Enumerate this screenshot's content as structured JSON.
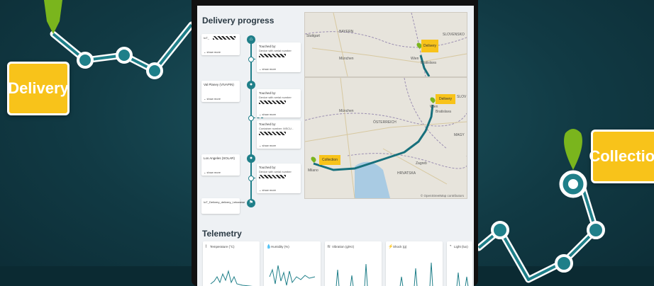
{
  "background_tags": {
    "delivery": "Delivery",
    "collection": "Collection"
  },
  "delivery_progress": {
    "title": "Delivery progress",
    "stops": [
      {
        "label": "",
        "view_more": "show more"
      },
      {
        "label": "Val Planey (VIVAPIN)",
        "view_more": "show more"
      },
      {
        "label": "Los Angeles (SOLAR)",
        "view_more": "show more"
      },
      {
        "label": "IoT_Delivery_delivery_Lebanese",
        "view_more": ""
      }
    ],
    "events": [
      {
        "title": "Touched by:",
        "sub": "Device with serial number",
        "view_more": "show more"
      },
      {
        "title": "Touched by:",
        "sub": "Device with serial number",
        "view_more": "show more"
      },
      {
        "title": "Touched by:",
        "sub": "Container number: MSCU -",
        "view_more": "show more"
      },
      {
        "title": "Touched by:",
        "sub": "Device with serial number",
        "view_more": "show more"
      }
    ]
  },
  "maps": {
    "top": {
      "labels": [
        "Stuttgart",
        "BAYERN",
        "München",
        "SLOVENSKO",
        "Wien",
        "Bratislava"
      ],
      "tag": "Delivery"
    },
    "bottom": {
      "labels": [
        "München",
        "ÖSTERREICH",
        "Wien",
        "Bratislava",
        "Zagreb",
        "HRVATSKA",
        "Milano",
        "SLOV",
        "MAGY"
      ],
      "tag_delivery": "Delivery",
      "tag_collection": "Collection",
      "copyright": "© OpenStreetMap contributors"
    }
  },
  "telemetry": {
    "title": "Telemetry",
    "tiles": [
      {
        "label": "Temperature (°C)",
        "icon": "thermometer-icon"
      },
      {
        "label": "Humidity (%)",
        "icon": "droplet-icon"
      },
      {
        "label": "Vibration (g/Hz)",
        "icon": "vibration-icon"
      },
      {
        "label": "Shock (g)",
        "icon": "shock-icon"
      },
      {
        "label": "Light (lux)",
        "icon": "light-icon"
      }
    ]
  },
  "colors": {
    "accent": "#1f7f89",
    "tag": "#f8c31a",
    "pin": "#7ab51d",
    "background": "#113a44"
  }
}
